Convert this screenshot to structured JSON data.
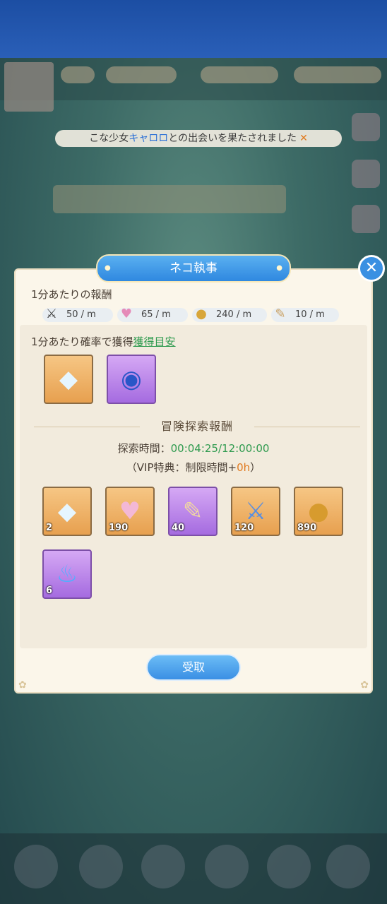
{
  "notice": {
    "before": "こな少女",
    "highlight": "キャロロ",
    "after": "との出会いを果たされました",
    "close": "✕"
  },
  "modal": {
    "title": "ネコ執事",
    "close_glyph": "✕",
    "per_minute_label": "1分あたりの報酬",
    "rates": [
      {
        "icon": "exp-swords-icon",
        "text": "50 / m"
      },
      {
        "icon": "exp-heart-icon",
        "text": "65 / m"
      },
      {
        "icon": "gold-coin-icon",
        "text": "240 / m"
      },
      {
        "icon": "scroll-icon",
        "text": "10 / m"
      }
    ],
    "chance_label": "1分あたり確率で獲得",
    "chance_link": "獲得目安",
    "chance_items": [
      {
        "icon": "crystal-icon",
        "rarity": "orange"
      },
      {
        "icon": "orb-icon",
        "rarity": "purple"
      }
    ],
    "section_title": "冒険探索報酬",
    "time_label": "探索時間：",
    "time_value": "00:04:25/12:00:00",
    "vip_prefix": "（VIP特典：制限時間+",
    "vip_value": "0h",
    "vip_suffix": "）",
    "rewards": [
      {
        "icon": "crystal-icon",
        "qty": "2",
        "rarity": "orange"
      },
      {
        "icon": "exp-heart-icon",
        "qty": "190",
        "rarity": "orange"
      },
      {
        "icon": "scroll-icon",
        "qty": "40",
        "rarity": "purple"
      },
      {
        "icon": "exp-swords-icon",
        "qty": "120",
        "rarity": "orange"
      },
      {
        "icon": "gold-coin-icon",
        "qty": "890",
        "rarity": "orange"
      },
      {
        "icon": "blue-flame-icon",
        "qty": "6",
        "rarity": "purple"
      }
    ],
    "receive_label": "受取"
  }
}
